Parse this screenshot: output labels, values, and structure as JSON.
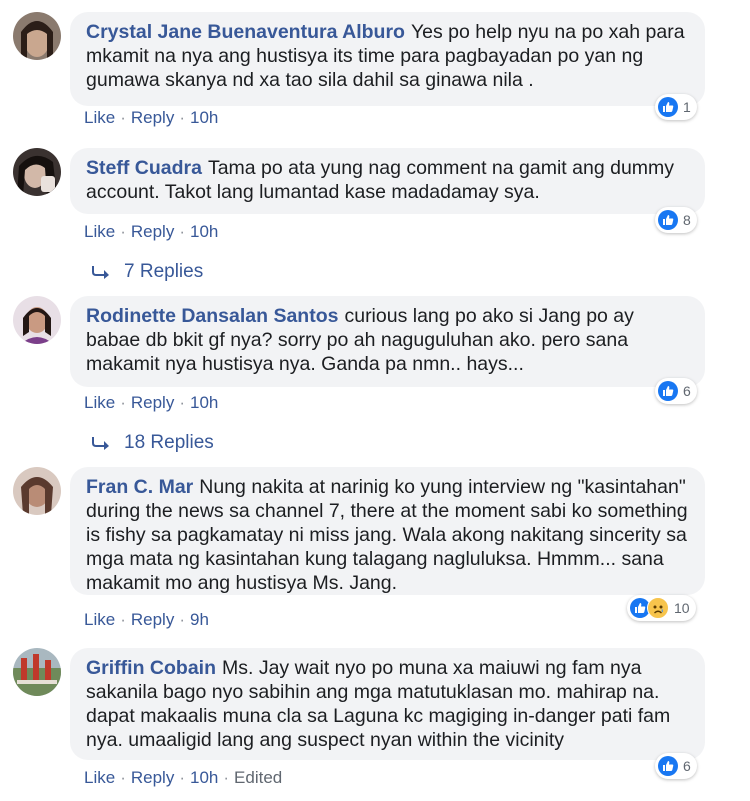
{
  "comments": [
    {
      "author": "Crystal Jane Buenaventura Alburo",
      "text": "Yes po help nyu na po xah para mkamit na nya ang hustisya its time para pagbayadan po yan ng gumawa skanya nd xa tao sila dahil sa ginawa nila .",
      "reactions": "1",
      "like": "Like",
      "reply": "Reply",
      "time": "10h"
    },
    {
      "author": "Steff Cuadra",
      "text": "Tama po ata yung nag comment na gamit ang dummy account. Takot lang lumantad kase madadamay sya.",
      "reactions": "8",
      "like": "Like",
      "reply": "Reply",
      "time": "10h",
      "replies_label": "7 Replies"
    },
    {
      "author": "Rodinette Dansalan Santos",
      "text": "curious lang po ako si Jang po ay babae db bkit gf nya? sorry po ah naguguluhan ako. pero sana makamit nya hustisya nya. Ganda pa nmn.. hays...",
      "reactions": "6",
      "like": "Like",
      "reply": "Reply",
      "time": "10h",
      "replies_label": "18 Replies"
    },
    {
      "author": "Fran C. Mar",
      "text": "Nung nakita at narinig ko yung interview ng \"kasintahan\" during the news sa channel 7, there at the moment sabi ko something is fishy sa pagkamatay ni miss jang. Wala akong nakitang sincerity sa mga mata ng kasintahan kung talagang nagluluksa. Hmmm... sana makamit mo ang hustisya Ms. Jang.",
      "reactions": "10",
      "like": "Like",
      "reply": "Reply",
      "time": "9h"
    },
    {
      "author": "Griffin Cobain",
      "text": "Ms. Jay wait nyo po muna xa maiuwi ng fam nya sakanila bago nyo sabihin ang mga matutuklasan mo. mahirap na. dapat makaalis muna cla sa Laguna kc magiging in-danger pati fam nya. umaaligid lang ang suspect nyan within the vicinity",
      "reactions": "6",
      "like": "Like",
      "reply": "Reply",
      "time": "10h",
      "edited": "Edited"
    }
  ],
  "colors": {
    "link": "#385898",
    "bubble": "#f2f3f5",
    "like_blue": "#1877f2",
    "meta_gray": "#606770"
  },
  "icons": [
    "like-reaction-icon",
    "sad-reaction-icon",
    "reply-arrow-icon"
  ]
}
